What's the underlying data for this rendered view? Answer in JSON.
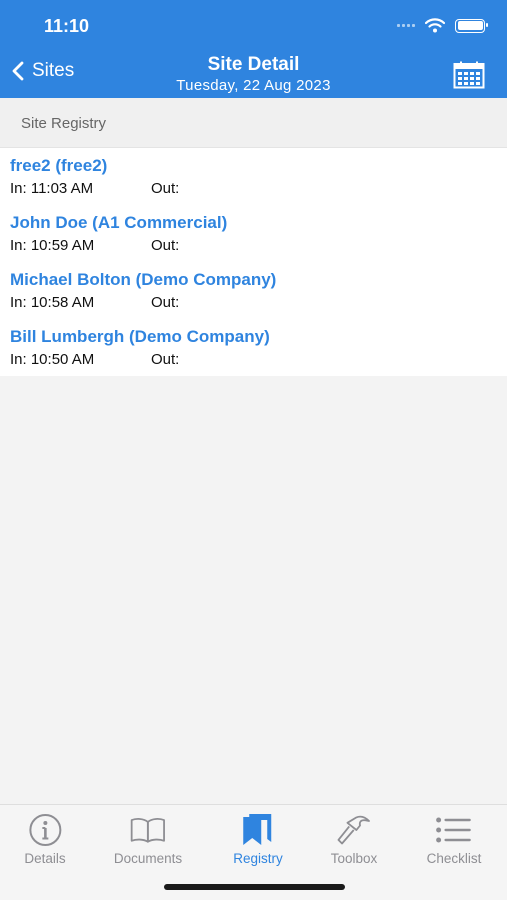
{
  "status_bar": {
    "time": "11:10"
  },
  "nav": {
    "back_label": "Sites",
    "title": "Site Detail",
    "subtitle": "Tuesday, 22 Aug 2023",
    "calendar_icon": "calendar-icon"
  },
  "section": {
    "label": "Site Registry"
  },
  "entries": [
    {
      "name": "free2 (free2)",
      "in": "In: 11:03 AM",
      "out": "Out:"
    },
    {
      "name": "John Doe (A1 Commercial)",
      "in": "In: 10:59 AM",
      "out": "Out:"
    },
    {
      "name": "Michael Bolton (Demo Company)",
      "in": "In: 10:58 AM",
      "out": "Out:"
    },
    {
      "name": "Bill Lumbergh (Demo Company)",
      "in": "In: 10:50 AM",
      "out": "Out:"
    }
  ],
  "tabs": [
    {
      "label": "Details",
      "icon": "info-icon",
      "active": false
    },
    {
      "label": "Documents",
      "icon": "book-icon",
      "active": false
    },
    {
      "label": "Registry",
      "icon": "bookmarks-icon",
      "active": true
    },
    {
      "label": "Toolbox",
      "icon": "hammer-icon",
      "active": false
    },
    {
      "label": "Checklist",
      "icon": "list-icon",
      "active": false
    }
  ],
  "colors": {
    "accent": "#2f84df",
    "inactive": "#8e8e93"
  }
}
